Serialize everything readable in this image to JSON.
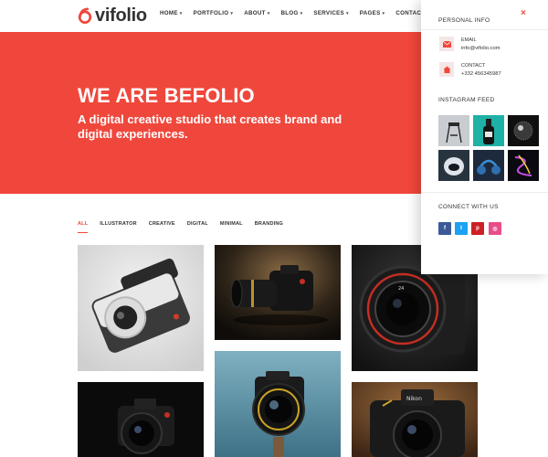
{
  "brand": {
    "name": "vifolio",
    "accent": "#f0473c"
  },
  "nav": {
    "items": [
      {
        "label": "HOME",
        "has_dropdown": true
      },
      {
        "label": "PORTFOLIO",
        "has_dropdown": true
      },
      {
        "label": "ABOUT",
        "has_dropdown": true
      },
      {
        "label": "BLOG",
        "has_dropdown": true
      },
      {
        "label": "SERVICES",
        "has_dropdown": true
      },
      {
        "label": "PAGES",
        "has_dropdown": true
      },
      {
        "label": "CONTACT US",
        "has_dropdown": false
      }
    ]
  },
  "hero": {
    "title": "WE ARE BEFOLIO",
    "subtitle": "A digital creative studio that creates brand and digital experiences."
  },
  "filters": {
    "active": "ALL",
    "items": [
      "ALL",
      "ILLUSTRATOR",
      "CREATIVE",
      "DIGITAL",
      "MINIMAL",
      "BRANDING"
    ]
  },
  "gallery": {
    "items": [
      {
        "name": "white-instant-camera",
        "icon": "camera-icon"
      },
      {
        "name": "dslr-dark-background",
        "icon": "camera-icon"
      },
      {
        "name": "cinema-lens-camera",
        "icon": "camera-icon"
      },
      {
        "name": "camera-on-tripod",
        "icon": "camera-icon"
      },
      {
        "name": "dslr-black-background",
        "icon": "camera-icon"
      },
      {
        "name": "nikon-camera",
        "icon": "camera-icon"
      }
    ]
  },
  "panel": {
    "close_label": "×",
    "personal_info": {
      "title": "PERSONAL INFO",
      "email_label": "EMAIL",
      "email_value": "info@vifolio.com",
      "contact_label": "CONTACT",
      "contact_value": "+332 456345987"
    },
    "instagram": {
      "title": "INSTAGRAM FEED"
    },
    "connect": {
      "title": "CONNECT WITH US",
      "links": [
        {
          "name": "facebook",
          "glyph": "f",
          "color": "#3b5998"
        },
        {
          "name": "twitter",
          "glyph": "t",
          "color": "#1da1f2"
        },
        {
          "name": "pinterest",
          "glyph": "p",
          "color": "#cb2027"
        },
        {
          "name": "dribbble",
          "glyph": "◎",
          "color": "#ea4c89"
        }
      ]
    }
  }
}
